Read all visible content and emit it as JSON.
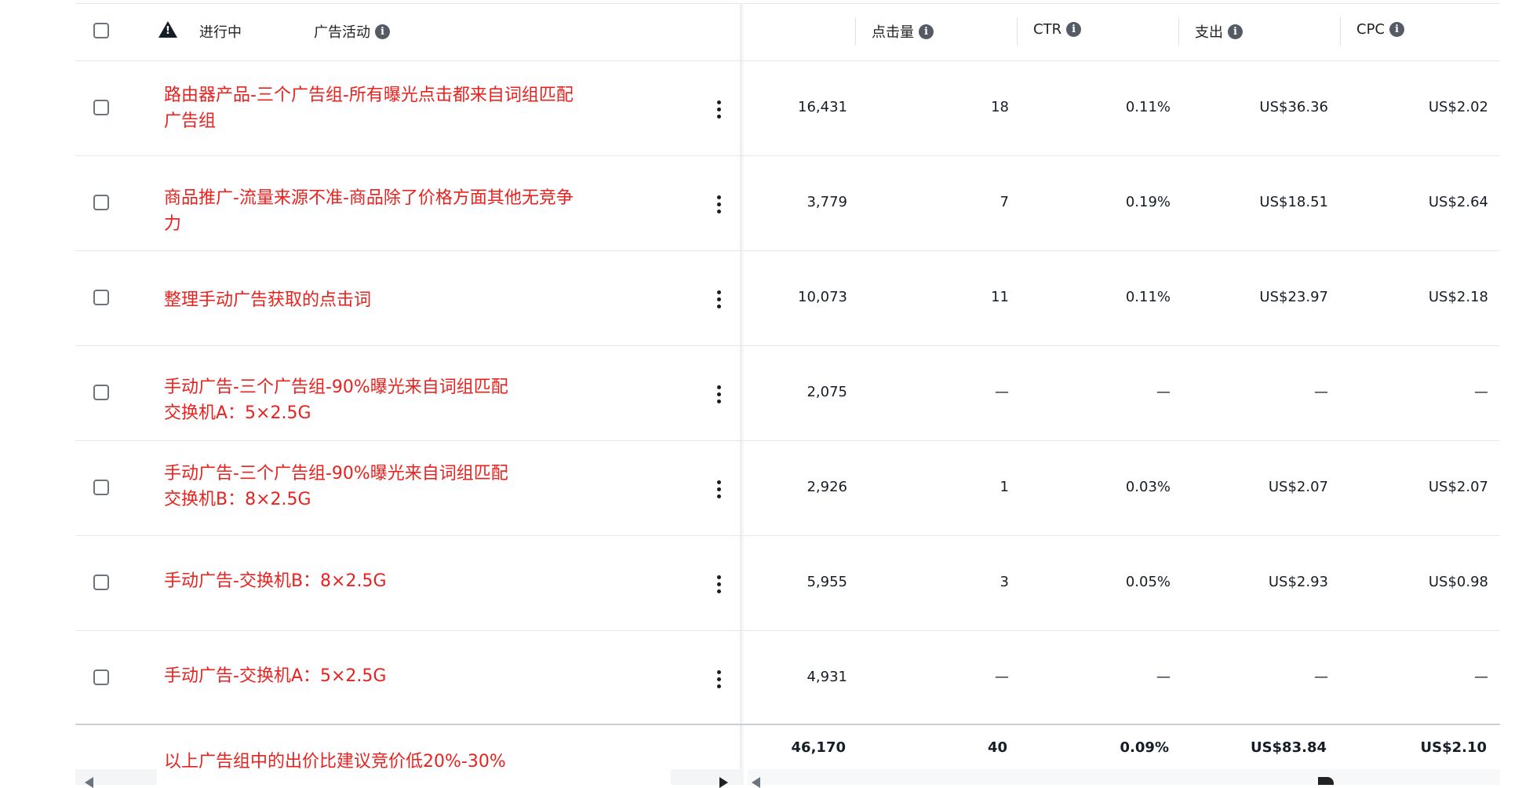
{
  "header": {
    "status_label": "进行中",
    "campaign_label": "广告活动",
    "clicks_label": "点击量",
    "ctr_label": "CTR",
    "spend_label": "支出",
    "cpc_label": "CPC",
    "info_glyph": "i",
    "warning_glyph": "!"
  },
  "rows": [
    {
      "campaign": "路由器产品-三个广告组-所有曝光点击都来自词组匹配\n广告组",
      "impressions": "16,431",
      "clicks": "18",
      "ctr": "0.11%",
      "spend": "US$36.36",
      "cpc": "US$2.02"
    },
    {
      "campaign": "商品推广-流量来源不准-商品除了价格方面其他无竞争\n力",
      "impressions": "3,779",
      "clicks": "7",
      "ctr": "0.19%",
      "spend": "US$18.51",
      "cpc": "US$2.64"
    },
    {
      "campaign": "整理手动广告获取的点击词",
      "impressions": "10,073",
      "clicks": "11",
      "ctr": "0.11%",
      "spend": "US$23.97",
      "cpc": "US$2.18"
    },
    {
      "campaign": "手动广告-三个广告组-90%曝光来自词组匹配\n交换机A：5×2.5G",
      "impressions": "2,075",
      "clicks": "—",
      "ctr": "—",
      "spend": "—",
      "cpc": "—"
    },
    {
      "campaign": "手动广告-三个广告组-90%曝光来自词组匹配\n交换机B：8×2.5G",
      "impressions": "2,926",
      "clicks": "1",
      "ctr": "0.03%",
      "spend": "US$2.07",
      "cpc": "US$2.07"
    },
    {
      "campaign": "手动广告-交换机B：8×2.5G",
      "impressions": "5,955",
      "clicks": "3",
      "ctr": "0.05%",
      "spend": "US$2.93",
      "cpc": "US$0.98"
    },
    {
      "campaign": "手动广告-交换机A：5×2.5G",
      "impressions": "4,931",
      "clicks": "—",
      "ctr": "—",
      "spend": "—",
      "cpc": "—"
    }
  ],
  "totals": {
    "note": "以上广告组中的出价比建议竞价低20%-30%",
    "impressions": "46,170",
    "clicks": "40",
    "ctr": "0.09%",
    "spend": "US$83.84",
    "cpc": "US$2.10"
  },
  "colors": {
    "annotation_red": "#e8221f",
    "text": "#161d26",
    "icon_gray": "#545b64"
  }
}
